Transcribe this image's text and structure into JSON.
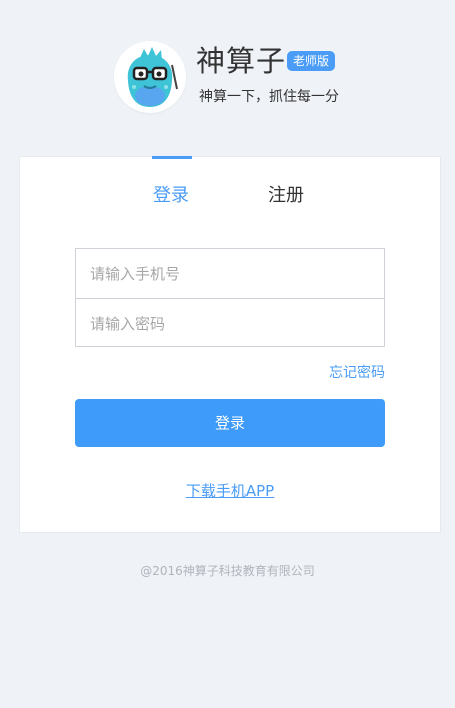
{
  "header": {
    "brand_name": "神算子",
    "badge": "老师版",
    "slogan": "神算一下，抓住每一分"
  },
  "tabs": [
    {
      "label": "登录",
      "active": true
    },
    {
      "label": "注册",
      "active": false
    }
  ],
  "form": {
    "phone_placeholder": "请输入手机号",
    "password_placeholder": "请输入密码",
    "forgot_label": "忘记密码",
    "login_label": "登录",
    "app_link_label": "下载手机APP"
  },
  "footer": {
    "copyright": "@2016神算子科技教育有限公司"
  },
  "colors": {
    "accent": "#4a9cf6",
    "button": "#3e9bf9",
    "background": "#eff2f7"
  }
}
